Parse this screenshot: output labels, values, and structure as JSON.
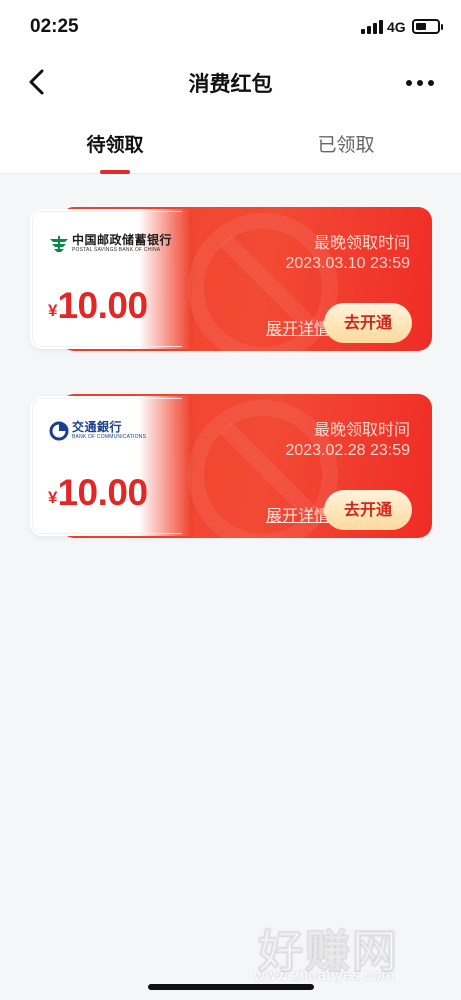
{
  "status_bar": {
    "time": "02:25",
    "network": "4G"
  },
  "nav": {
    "title": "消费红包"
  },
  "tabs": [
    {
      "label": "待领取",
      "active": true
    },
    {
      "label": "已领取",
      "active": false
    }
  ],
  "coupons": [
    {
      "bank_name_cn": "中国邮政储蓄银行",
      "bank_name_en": "POSTAL SAVINGS BANK OF CHINA",
      "currency_symbol": "¥",
      "amount": "10.00",
      "deadline_label": "最晚领取时间",
      "deadline": "2023.03.10 23:59",
      "details_label": "展开详情",
      "activate_label": "去开通"
    },
    {
      "bank_name_cn": "交通銀行",
      "bank_name_en": "BANK OF COMMUNICATIONS",
      "currency_symbol": "¥",
      "amount": "10.00",
      "deadline_label": "最晚领取时间",
      "deadline": "2023.02.28 23:59",
      "details_label": "展开详情",
      "activate_label": "去开通"
    }
  ],
  "watermark": {
    "text_cn": "好赚网",
    "text_en": "www.zhuanyes.com"
  },
  "colors": {
    "accent": "#e02b2b",
    "coupon_red": "#f0402e",
    "button_gold": "#ffd99d",
    "psbc_green": "#0a8a4a",
    "bocom_blue": "#1b3f8f"
  },
  "icons": {
    "back": "chevron-left-icon",
    "more": "more-dots-icon",
    "bank1": "psbc-logo-icon",
    "bank2": "bocom-logo-icon"
  }
}
